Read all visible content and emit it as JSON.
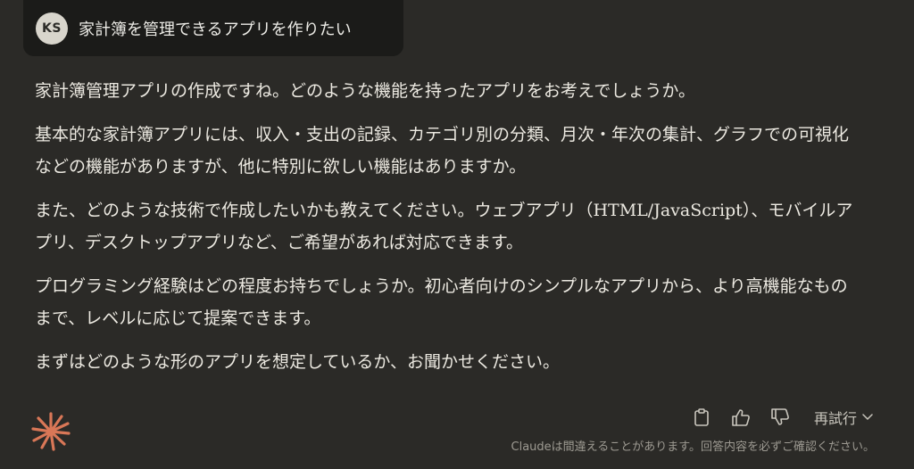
{
  "user_message": {
    "avatar_initials": "KS",
    "text": "家計簿を管理できるアプリを作りたい"
  },
  "response": {
    "paragraphs": [
      "家計簿管理アプリの作成ですね。どのような機能を持ったアプリをお考えでしょうか。",
      "基本的な家計簿アプリには、収入・支出の記録、カテゴリ別の分類、月次・年次の集計、グラフでの可視化などの機能がありますが、他に特別に欲しい機能はありますか。",
      "また、どのような技術で作成したいかも教えてください。ウェブアプリ（HTML/JavaScript）、モバイルアプリ、デスクトップアプリなど、ご希望があれば対応できます。",
      "プログラミング経験はどの程度お持ちでしょうか。初心者向けのシンプルなアプリから、より高機能なものまで、レベルに応じて提案できます。",
      "まずはどのような形のアプリを想定しているか、お聞かせください。"
    ]
  },
  "actions": {
    "copy_icon": "clipboard-icon",
    "thumbs_up_icon": "thumbs-up-icon",
    "thumbs_down_icon": "thumbs-down-icon",
    "retry_label": "再試行",
    "retry_icon": "chevron-down-icon"
  },
  "disclaimer": "Claudeは間違えることがあります。回答内容を必ずご確認ください。",
  "colors": {
    "background": "#2b2a27",
    "user_bubble": "#1b1b19",
    "text": "#ece9e1",
    "brand": "#d97757",
    "muted": "#9d9a92"
  }
}
